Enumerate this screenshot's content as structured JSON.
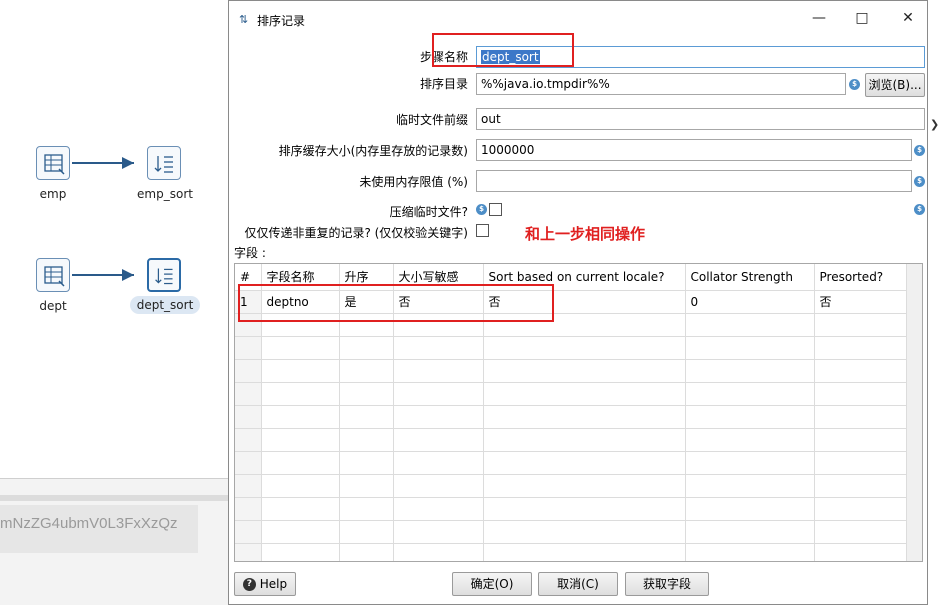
{
  "canvas": {
    "nodes": [
      {
        "label": "emp"
      },
      {
        "label": "emp_sort"
      },
      {
        "label": "dept"
      },
      {
        "label": "dept_sort"
      }
    ],
    "encoded_text": "mNzZG4ubmV0L3FxXzQz"
  },
  "dialog": {
    "title": "排序记录",
    "title_icon": "sort-icon",
    "step_name_label": "步骤名称",
    "step_name_value": "dept_sort",
    "sort_dir_label": "排序目录",
    "sort_dir_value": "%%java.io.tmpdir%%",
    "browse_label": "浏览(B)...",
    "prefix_label": "临时文件前缀",
    "prefix_value": "out",
    "buffer_label": "排序缓存大小(内存里存放的记录数)",
    "buffer_value": "1000000",
    "free_mem_label": "未使用内存限值 (%)",
    "free_mem_value": "",
    "compress_label": "压缩临时文件?",
    "unique_label": "仅仅传递非重复的记录? (仅仅校验关键字)",
    "annotation": "和上一步相同操作",
    "fields_label": "字段 :",
    "table": {
      "headers": [
        "#",
        "字段名称",
        "升序",
        "大小写敏感",
        "Sort based on current locale?",
        "Collator Strength",
        "Presorted?"
      ],
      "rows": [
        [
          "1",
          "deptno",
          "是",
          "否",
          "否",
          "0",
          "否"
        ]
      ]
    },
    "buttons": {
      "help": "Help",
      "ok": "确定(O)",
      "cancel": "取消(C)",
      "get_fields": "获取字段"
    },
    "colors": {
      "accent": "#3c78c8",
      "annotation": "#e02020"
    }
  }
}
